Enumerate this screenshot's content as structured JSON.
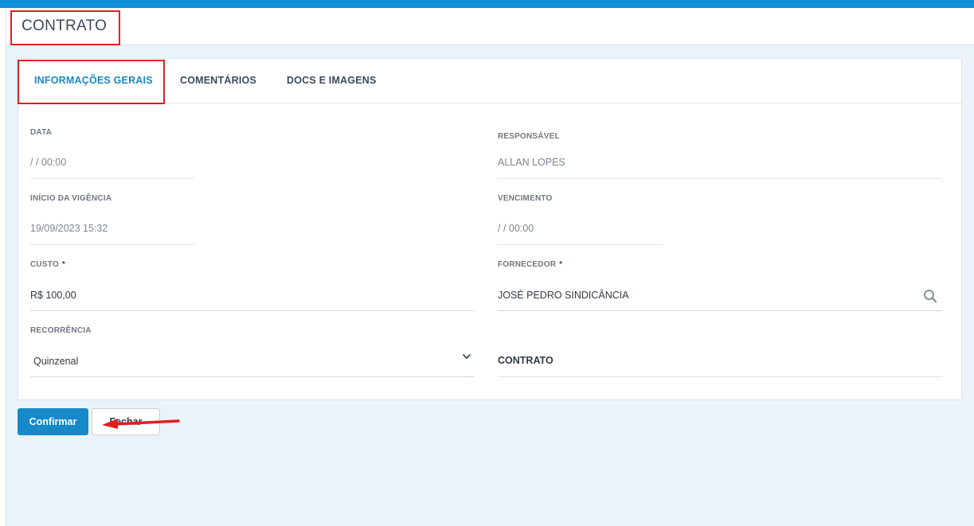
{
  "header": {
    "title": "CONTRATO"
  },
  "tabs": [
    {
      "label": "INFORMAÇÕES GERAIS",
      "active": true
    },
    {
      "label": "COMENTÁRIOS",
      "active": false
    },
    {
      "label": "DOCS E IMAGENS",
      "active": false
    }
  ],
  "form": {
    "data": {
      "label": "DATA",
      "value": "/ / 00:00"
    },
    "responsavel": {
      "label": "RESPONSÁVEL",
      "value": "ALLAN LOPES"
    },
    "inicio_vigencia": {
      "label": "INÍCIO DA VIGÊNCIA",
      "value": "19/09/2023 15:32"
    },
    "vencimento": {
      "label": "VENCIMENTO",
      "value": "/ / 00:00"
    },
    "custo": {
      "label": "CUSTO",
      "required": "*",
      "value": "R$ 100,00"
    },
    "fornecedor": {
      "label": "FORNECEDOR",
      "required": "*",
      "value": "JOSÉ PEDRO SINDICÂNCIA",
      "icon": "search-icon"
    },
    "recorrencia": {
      "label": "RECORRÊNCIA",
      "value": "Quinzenal",
      "icon": "chevron-down-icon"
    },
    "contrato_section": {
      "label": "CONTRATO"
    }
  },
  "buttons": {
    "confirm": "Confirmar",
    "close": "Fechar"
  },
  "colors": {
    "accent": "#1689c9",
    "topbar": "#0f8ed6",
    "highlight": "#e21d1d",
    "background": "#ebf3fa"
  }
}
